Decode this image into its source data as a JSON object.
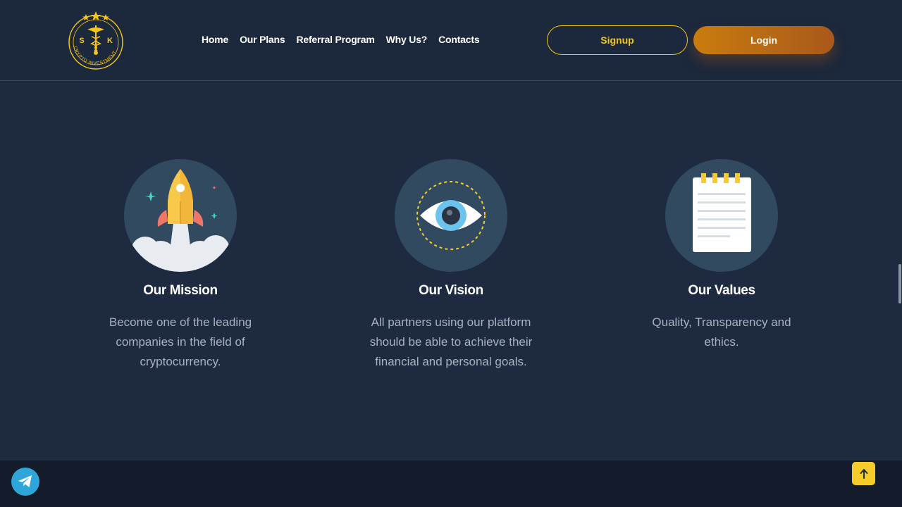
{
  "header": {
    "logo": {
      "letters_left": "S",
      "letters_right": "K",
      "ring_text": "CRYPTO INVESTMENT"
    },
    "nav": [
      {
        "label": "Home"
      },
      {
        "label": "Our Plans"
      },
      {
        "label": "Referral Program"
      },
      {
        "label": "Why Us?"
      },
      {
        "label": "Contacts"
      }
    ],
    "signup_label": "Signup",
    "login_label": "Login"
  },
  "cards": [
    {
      "icon": "rocket-icon",
      "title": "Our Mission",
      "text": "Become one of the leading companies in the field of cryptocurrency."
    },
    {
      "icon": "eye-icon",
      "title": "Our Vision",
      "text": "All partners using our platform should be able to achieve their financial and personal goals."
    },
    {
      "icon": "notepad-icon",
      "title": "Our Values",
      "text": "Quality, Transparency and ethics."
    }
  ],
  "floating": {
    "telegram_icon": "telegram-icon",
    "back_to_top_icon": "arrow-up-icon"
  },
  "colors": {
    "background": "#1e2a3f",
    "accent_yellow": "#f5c518",
    "login_gradient_start": "#c97c0e",
    "login_gradient_end": "#a9581a",
    "icon_circle": "#324a60"
  }
}
